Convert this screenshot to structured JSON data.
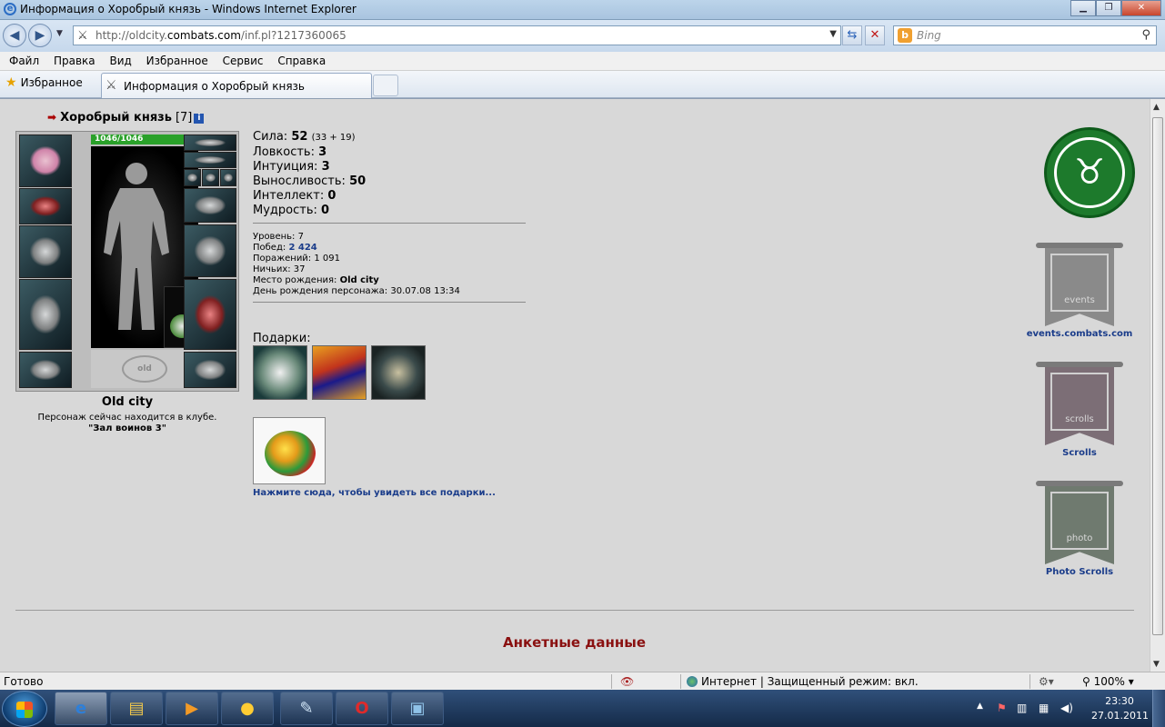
{
  "window": {
    "title": "Информация о Хоробрый князь - Windows Internet Explorer"
  },
  "address": {
    "url_prefix": "http://oldcity.",
    "url_domain": "combats.com",
    "url_rest": "/inf.pl?1217360065"
  },
  "search": {
    "placeholder": "Bing"
  },
  "menu": [
    "Файл",
    "Правка",
    "Вид",
    "Избранное",
    "Сервис",
    "Справка"
  ],
  "favorites": {
    "label": "Избранное"
  },
  "tab": {
    "label": "Информация о Хоробрый князь"
  },
  "character": {
    "name": "Хоробрый князь",
    "level": "[7]",
    "info_badge": "i",
    "hp": "1046/1046",
    "club_emblem": "old",
    "city": "Old city",
    "location_line1": "Персонаж сейчас находится в клубе.",
    "location_line2": "\"Зал воинов 3\""
  },
  "stats": [
    {
      "label": "Сила:",
      "value": "52",
      "extra": "(33 + 19)"
    },
    {
      "label": "Ловкость:",
      "value": "3",
      "extra": ""
    },
    {
      "label": "Интуиция:",
      "value": "3",
      "extra": ""
    },
    {
      "label": "Выносливость:",
      "value": "50",
      "extra": ""
    },
    {
      "label": "Интеллект:",
      "value": "0",
      "extra": ""
    },
    {
      "label": "Мудрость:",
      "value": "0",
      "extra": ""
    }
  ],
  "record": {
    "level": {
      "label": "Уровень:",
      "value": "7"
    },
    "wins": {
      "label": "Побед:",
      "value": "2 424"
    },
    "losses": {
      "label": "Поражений:",
      "value": "1 091"
    },
    "draws": {
      "label": "Ничьих:",
      "value": "37"
    },
    "birthplace": {
      "label": "Место рождения:",
      "value": "Old city"
    },
    "birthday": {
      "label": "День рождения персонажа:",
      "value": "30.07.08 13:34"
    }
  },
  "gifts": {
    "label": "Подарки:",
    "see_all": "Нажмите сюда, чтобы увидеть все подарки..."
  },
  "sidebar": {
    "events_label": "events.combats.com",
    "events_banner": "events",
    "scrolls_label": "Scrolls",
    "scrolls_banner": "scrolls",
    "photo_label": "Photo Scrolls",
    "photo_banner": "photo"
  },
  "section": {
    "anketa": "Анкетные данные"
  },
  "statusbar": {
    "left": "Готово",
    "zone": "Интернет | Защищенный режим: вкл.",
    "zoom": "100%"
  },
  "clock": {
    "time": "23:30",
    "date": "27.01.2011"
  }
}
